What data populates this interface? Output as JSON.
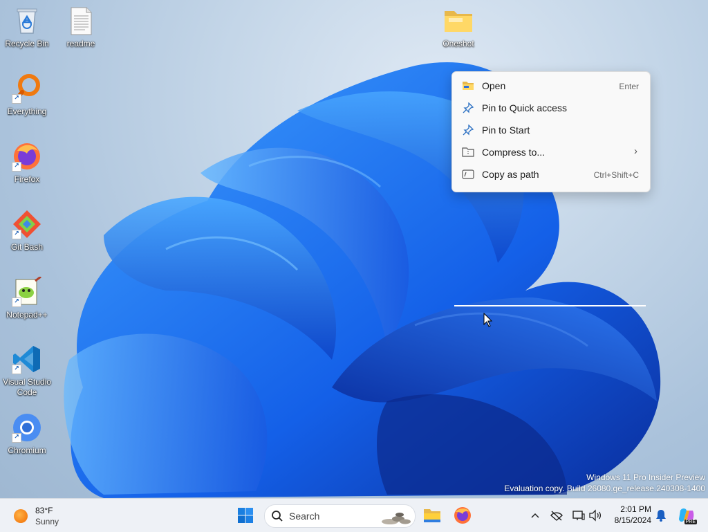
{
  "desktop": {
    "icons": [
      {
        "label": "Recycle Bin",
        "icon": "recycle-bin-icon"
      },
      {
        "label": "readme",
        "icon": "text-file-icon"
      },
      {
        "label": "Oneshot",
        "icon": "folder-icon"
      },
      {
        "label": "Everything",
        "icon": "everything-search-icon"
      },
      {
        "label": "Firefox",
        "icon": "firefox-icon"
      },
      {
        "label": "Git Bash",
        "icon": "git-bash-icon"
      },
      {
        "label": "Notepad++",
        "icon": "notepad-plus-plus-icon"
      },
      {
        "label": "Visual Studio Code",
        "icon": "vscode-icon"
      },
      {
        "label": "Chromium",
        "icon": "chromium-icon"
      }
    ]
  },
  "context_menu": {
    "items": [
      {
        "label": "Open",
        "shortcut": "Enter",
        "icon": "folder-open-icon"
      },
      {
        "label": "Pin to Quick access",
        "shortcut": "",
        "icon": "pin-icon"
      },
      {
        "label": "Pin to Start",
        "shortcut": "",
        "icon": "pin-icon"
      },
      {
        "label": "Compress to...",
        "shortcut": "",
        "icon": "zip-folder-icon",
        "submenu": true
      },
      {
        "label": "Copy as path",
        "shortcut": "Ctrl+Shift+C",
        "icon": "copy-path-icon"
      }
    ],
    "submenu_arrow": "›"
  },
  "watermark": {
    "line1": "Windows 11 Pro Insider Preview",
    "line2": "Evaluation copy. Build 26080.ge_release.240308-1400"
  },
  "taskbar": {
    "weather": {
      "temp": "83°F",
      "condition": "Sunny"
    },
    "search": {
      "placeholder": "Search"
    },
    "apps": [
      "file-explorer-icon",
      "firefox-icon"
    ],
    "tray": {
      "icons": [
        "chevron-up-icon",
        "network-off-icon",
        "display-icon",
        "speaker-icon",
        "bell-icon",
        "copilot-icon"
      ],
      "time": "2:01 PM",
      "date": "8/15/2024",
      "copilot_badge": "PRE"
    }
  },
  "colors": {
    "accent": "#0067c0",
    "bloom": "#1a6ef0",
    "taskbar": "#eef1f6"
  }
}
